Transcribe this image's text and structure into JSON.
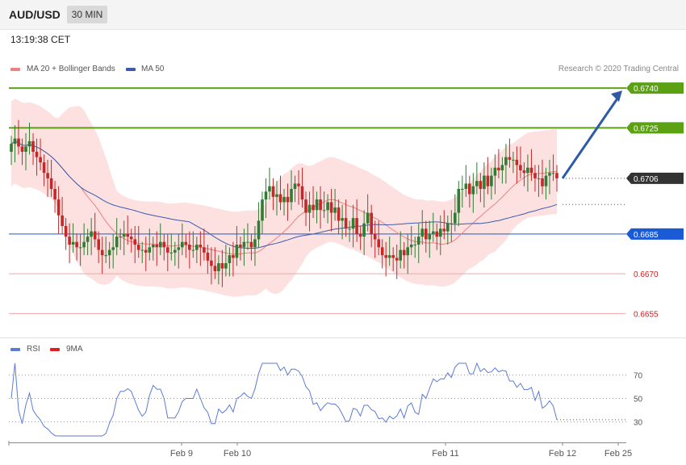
{
  "header": {
    "pair": "AUD/USD",
    "timeframe": "30 MIN"
  },
  "timestamp": "13:19:38 CET",
  "legend": {
    "ma20": "MA 20 + Bollinger Bands",
    "ma50": "MA 50",
    "rsi": "RSI",
    "ma9": "9MA"
  },
  "credit": "Research © 2020 Trading Central",
  "colors": {
    "up": "#2e7d32",
    "down": "#c62828",
    "band": "#fcd6d6",
    "ma50": "#3b5bad",
    "ma20": "#f08080",
    "target": "#5ca014",
    "pivot": "#1a5ad6",
    "support": "#cc1f1f",
    "current": "#333333",
    "rsi": "#5b7bd5",
    "arrow": "#2e5aa6"
  },
  "chart_data": [
    {
      "type": "candlestick",
      "symbol": "AUD/USD",
      "timeframe": "30 MIN",
      "ylim": [
        0.6646,
        0.6744
      ],
      "x_ticks": [
        "Feb 9",
        "Feb 10",
        "Feb 11",
        "Feb 12",
        "Feb 25"
      ],
      "levels": [
        {
          "label": "0.6740",
          "value": 0.674,
          "kind": "target"
        },
        {
          "label": "0.6725",
          "value": 0.6725,
          "kind": "target"
        },
        {
          "label": "0.6706",
          "value": 0.6706,
          "kind": "current"
        },
        {
          "label": "0.6685",
          "value": 0.6685,
          "kind": "pivot"
        },
        {
          "label": "0.6670",
          "value": 0.667,
          "kind": "support"
        },
        {
          "label": "0.6655",
          "value": 0.6655,
          "kind": "support"
        }
      ],
      "forecast_arrow": {
        "from": 0.6706,
        "to": 0.674
      },
      "close": [
        0.6719,
        0.6721,
        0.6718,
        0.6716,
        0.6718,
        0.672,
        0.6716,
        0.6714,
        0.6712,
        0.6708,
        0.6706,
        0.6702,
        0.6698,
        0.6692,
        0.6688,
        0.6684,
        0.6681,
        0.6682,
        0.668,
        0.668,
        0.6682,
        0.6684,
        0.6686,
        0.6683,
        0.6679,
        0.6677,
        0.6677,
        0.6679,
        0.668,
        0.6684,
        0.6684,
        0.6685,
        0.6684,
        0.6683,
        0.6681,
        0.6679,
        0.6679,
        0.6678,
        0.668,
        0.6681,
        0.668,
        0.6682,
        0.668,
        0.6678,
        0.6678,
        0.6679,
        0.668,
        0.6682,
        0.6681,
        0.6679,
        0.6679,
        0.6681,
        0.668,
        0.6678,
        0.6675,
        0.6673,
        0.6671,
        0.6674,
        0.6672,
        0.6674,
        0.6677,
        0.6676,
        0.6681,
        0.668,
        0.6682,
        0.6682,
        0.668,
        0.6683,
        0.669,
        0.6698,
        0.6701,
        0.6703,
        0.6699,
        0.67,
        0.6697,
        0.6699,
        0.6697,
        0.6702,
        0.6704,
        0.6703,
        0.6698,
        0.6693,
        0.6696,
        0.6694,
        0.6698,
        0.6694,
        0.6694,
        0.6697,
        0.6693,
        0.6695,
        0.669,
        0.6691,
        0.6687,
        0.6687,
        0.6691,
        0.6685,
        0.6684,
        0.6689,
        0.6693,
        0.6685,
        0.6683,
        0.668,
        0.6677,
        0.6676,
        0.6677,
        0.6676,
        0.6675,
        0.6679,
        0.6677,
        0.668,
        0.6681,
        0.6681,
        0.6684,
        0.6687,
        0.6683,
        0.6685,
        0.6686,
        0.6684,
        0.6687,
        0.6686,
        0.6689,
        0.6689,
        0.6693,
        0.6702,
        0.6702,
        0.6704,
        0.67,
        0.6703,
        0.6705,
        0.6702,
        0.6707,
        0.6703,
        0.6707,
        0.671,
        0.6709,
        0.6711,
        0.6714,
        0.6713,
        0.6713,
        0.6711,
        0.6709,
        0.6708,
        0.671,
        0.6708,
        0.6706,
        0.6706,
        0.6703,
        0.6707,
        0.6708,
        0.6708,
        0.6706
      ],
      "series": [
        {
          "name": "MA 20 + Bollinger Bands"
        },
        {
          "name": "MA 50"
        }
      ]
    },
    {
      "type": "line",
      "ylim": [
        18,
        80
      ],
      "y_ticks": [
        30,
        50,
        70
      ],
      "series": [
        {
          "name": "RSI"
        },
        {
          "name": "9MA"
        }
      ]
    }
  ]
}
